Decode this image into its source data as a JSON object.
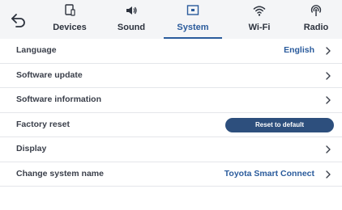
{
  "nav": {
    "back_icon": "back-arrow-icon",
    "tabs": [
      {
        "id": "devices",
        "label": "Devices",
        "icon": "phone-icon",
        "active": false
      },
      {
        "id": "sound",
        "label": "Sound",
        "icon": "speaker-icon",
        "active": false
      },
      {
        "id": "system",
        "label": "System",
        "icon": "system-screen-icon",
        "active": true
      },
      {
        "id": "wifi",
        "label": "Wi-Fi",
        "icon": "wifi-icon",
        "active": false
      },
      {
        "id": "radio",
        "label": "Radio",
        "icon": "radio-icon",
        "active": false
      }
    ]
  },
  "settings": [
    {
      "id": "language",
      "label": "Language",
      "value": "English",
      "chevron": true
    },
    {
      "id": "software-update",
      "label": "Software update",
      "value": "",
      "chevron": true
    },
    {
      "id": "software-information",
      "label": "Software information",
      "value": "",
      "chevron": true
    },
    {
      "id": "factory-reset",
      "label": "Factory reset",
      "button_label": "Reset to default",
      "chevron": false
    },
    {
      "id": "display",
      "label": "Display",
      "value": "",
      "chevron": true
    },
    {
      "id": "change-system-name",
      "label": "Change system name",
      "value": "Toyota Smart Connect",
      "chevron": true
    }
  ],
  "colors": {
    "accent": "#2a5b9c",
    "button_bg": "#2d4f7d",
    "topbar_bg": "#f4f5f7",
    "divider": "#e4e6ea"
  }
}
